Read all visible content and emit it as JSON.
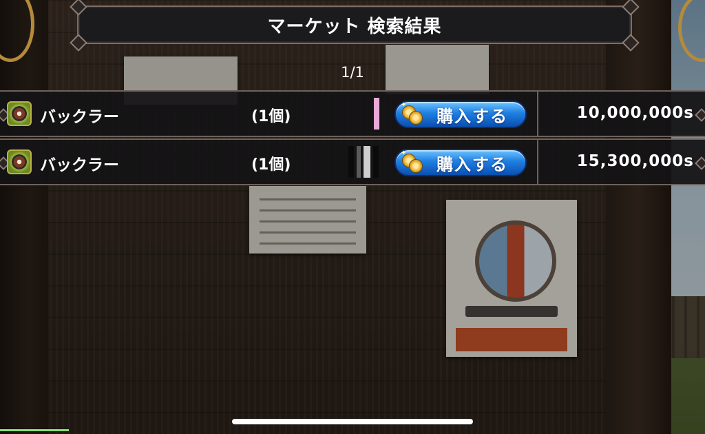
{
  "header": {
    "title": "マーケット 検索結果"
  },
  "pagination": {
    "indicator": "1/1"
  },
  "listings": [
    {
      "name": "バックラー",
      "quantity": "(1個)",
      "buy_label": "購入する",
      "price": "10,000,000s",
      "icon": "buckler-shield-icon"
    },
    {
      "name": "バックラー",
      "quantity": "(1個)",
      "buy_label": "購入する",
      "price": "15,300,000s",
      "icon": "buckler-shield-icon"
    }
  ],
  "colors": {
    "button_blue": "#1f7fe2",
    "panel": "#1b1a1c",
    "border": "#7d6f66"
  }
}
